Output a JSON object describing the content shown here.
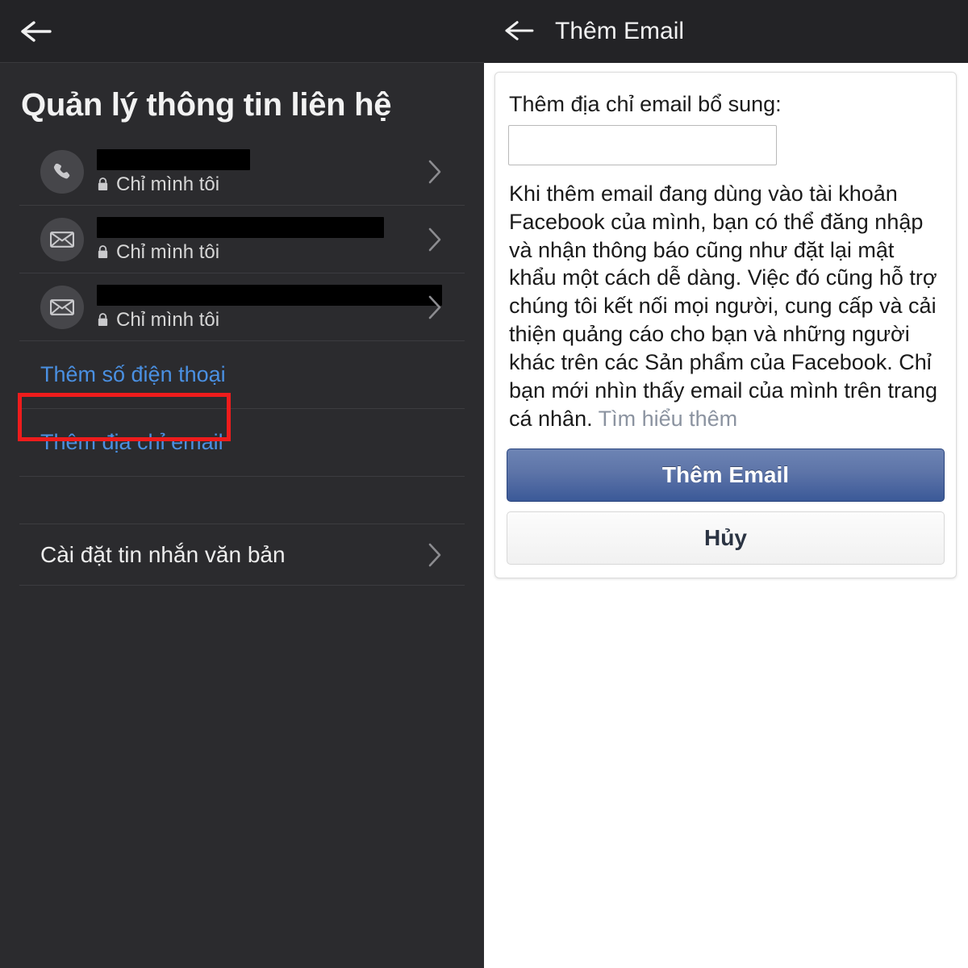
{
  "left": {
    "back_icon": "arrow-left-icon",
    "title": "Quản lý thông tin liên hệ",
    "contacts": [
      {
        "icon": "phone-icon",
        "value_redacted": true,
        "privacy": "Chỉ mình tôi",
        "chevron": "chevron-right-icon"
      },
      {
        "icon": "envelope-icon",
        "value_redacted": true,
        "privacy": "Chỉ mình tôi",
        "chevron": "chevron-right-icon"
      },
      {
        "icon": "envelope-icon",
        "value_redacted": true,
        "privacy": "Chỉ mình tôi",
        "chevron": "chevron-right-icon"
      }
    ],
    "add_phone_label": "Thêm số điện thoại",
    "add_email_label": "Thêm địa chỉ email",
    "sms_settings_label": "Cài đặt tin nhắn văn bản",
    "colors": {
      "background": "#2b2b2e",
      "appbar": "#232326",
      "link": "#4a90e2",
      "divider": "#3c3c40",
      "text": "#ededed"
    }
  },
  "right": {
    "back_icon": "arrow-left-icon",
    "title": "Thêm Email",
    "field_label": "Thêm địa chỉ email bổ sung:",
    "input_value": "",
    "input_placeholder": "",
    "body_text": "Khi thêm email đang dùng vào tài khoản Facebook của mình, bạn có thể đăng nhập và nhận thông báo cũng như đặt lại mật khẩu một cách dễ dàng. Việc đó cũng hỗ trợ chúng tôi kết nối mọi người, cung cấp và cải thiện quảng cáo cho bạn và những người khác trên các Sản phẩm của Facebook. Chỉ bạn mới nhìn thấy email của mình trên trang cá nhân. ",
    "learn_more_label": "Tìm hiểu thêm",
    "submit_label": "Thêm Email",
    "cancel_label": "Hủy",
    "colors": {
      "appbar": "#232326",
      "submit_button": "#3b5998",
      "cancel_button": "#f1f1f1",
      "learn_more": "#8b93a0"
    }
  },
  "annotations": {
    "red_box_color": "#ee1c1c",
    "orange_box_color": "#e8841f",
    "red_box_left_target": "Thêm địa chỉ email",
    "red_box_right_target": "Thêm địa chỉ email bổ sung:",
    "orange_box_right_target": "Thêm Email"
  }
}
